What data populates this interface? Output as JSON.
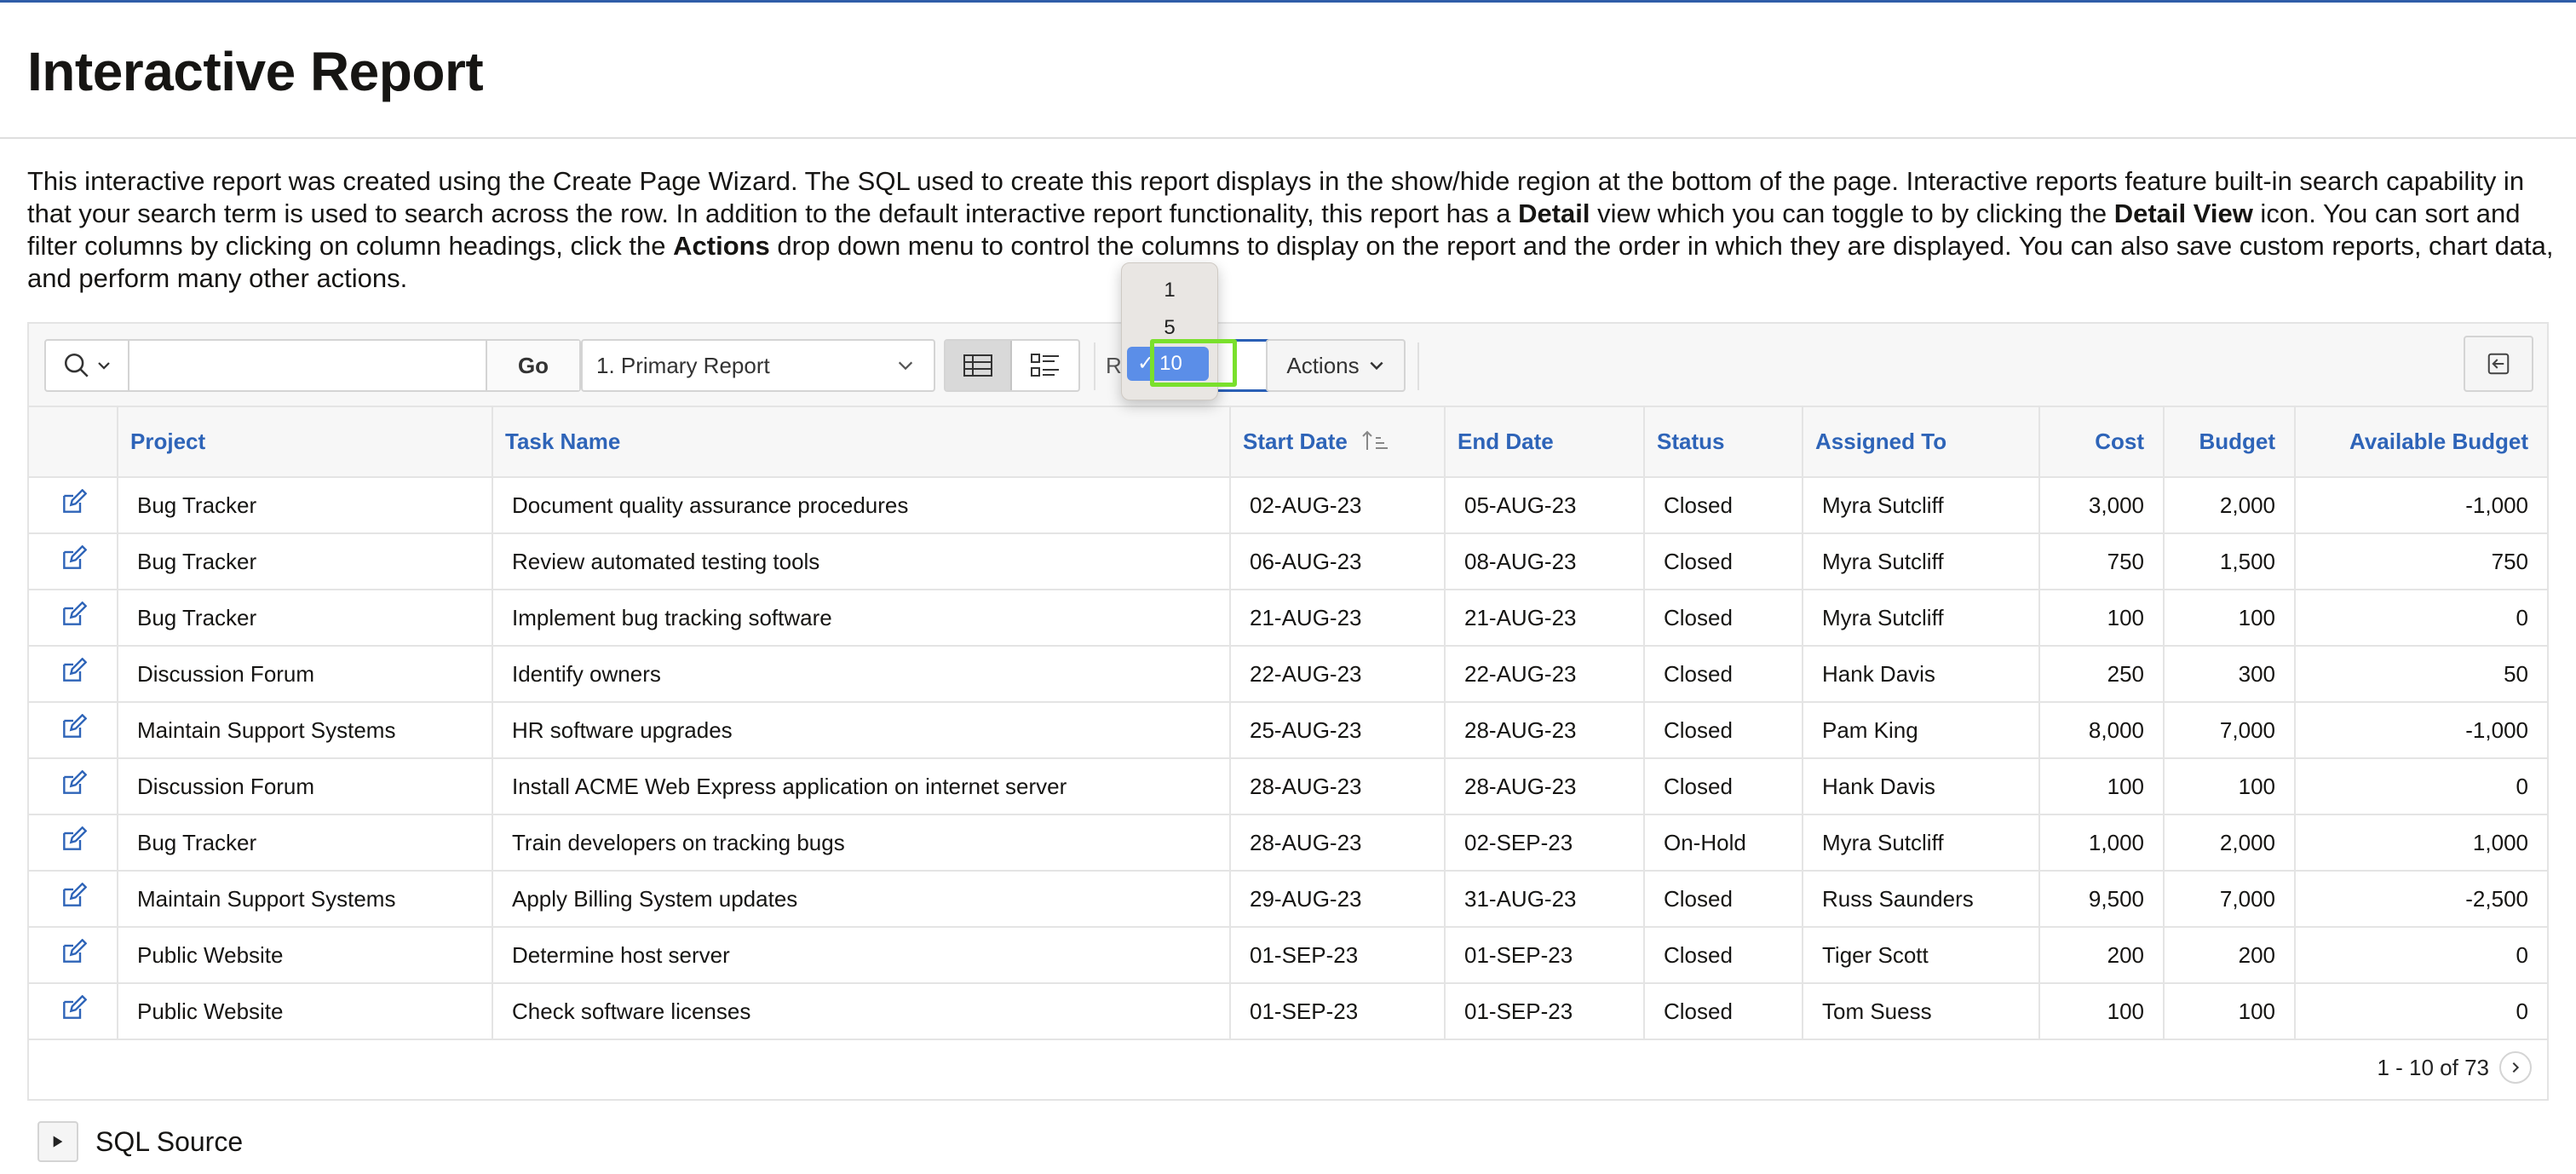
{
  "page": {
    "title": "Interactive Report",
    "description": [
      {
        "text": "This interactive report was created using the Create Page Wizard. The SQL used to create this report displays in the show/hide region at the bottom of the page. Interactive reports feature built-in search capability in that your search term is used to search across the row. In addition to the default interactive report functionality, this report has a ",
        "bold": false
      },
      {
        "text": "Detail",
        "bold": true
      },
      {
        "text": " view which you can toggle to by clicking the ",
        "bold": false
      },
      {
        "text": "Detail View",
        "bold": true
      },
      {
        "text": " icon. You can sort and filter columns by clicking on column headings, click the ",
        "bold": false
      },
      {
        "text": "Actions",
        "bold": true
      },
      {
        "text": " drop down menu to control the columns to display on the report and the order in which they are displayed. You can also save custom reports, chart data, and perform many other actions.",
        "bold": false
      }
    ]
  },
  "toolbar": {
    "search_value": "",
    "go_label": "Go",
    "report_selected": "1. Primary Report",
    "rows_label": "Row",
    "actions_label": "Actions"
  },
  "rows_menu": {
    "options": [
      "1",
      "5",
      "10"
    ],
    "selected": "10"
  },
  "table": {
    "columns": [
      "",
      "Project",
      "Task Name",
      "Start Date",
      "End Date",
      "Status",
      "Assigned To",
      "Cost",
      "Budget",
      "Available Budget"
    ],
    "sorted_column": "Start Date",
    "rows": [
      [
        "Bug Tracker",
        "Document quality assurance procedures",
        "02-AUG-23",
        "05-AUG-23",
        "Closed",
        "Myra Sutcliff",
        "3,000",
        "2,000",
        "-1,000"
      ],
      [
        "Bug Tracker",
        "Review automated testing tools",
        "06-AUG-23",
        "08-AUG-23",
        "Closed",
        "Myra Sutcliff",
        "750",
        "1,500",
        "750"
      ],
      [
        "Bug Tracker",
        "Implement bug tracking software",
        "21-AUG-23",
        "21-AUG-23",
        "Closed",
        "Myra Sutcliff",
        "100",
        "100",
        "0"
      ],
      [
        "Discussion Forum",
        "Identify owners",
        "22-AUG-23",
        "22-AUG-23",
        "Closed",
        "Hank Davis",
        "250",
        "300",
        "50"
      ],
      [
        "Maintain Support Systems",
        "HR software upgrades",
        "25-AUG-23",
        "28-AUG-23",
        "Closed",
        "Pam King",
        "8,000",
        "7,000",
        "-1,000"
      ],
      [
        "Discussion Forum",
        "Install ACME Web Express application on internet server",
        "28-AUG-23",
        "28-AUG-23",
        "Closed",
        "Hank Davis",
        "100",
        "100",
        "0"
      ],
      [
        "Bug Tracker",
        "Train developers on tracking bugs",
        "28-AUG-23",
        "02-SEP-23",
        "On-Hold",
        "Myra Sutcliff",
        "1,000",
        "2,000",
        "1,000"
      ],
      [
        "Maintain Support Systems",
        "Apply Billing System updates",
        "29-AUG-23",
        "31-AUG-23",
        "Closed",
        "Russ Saunders",
        "9,500",
        "7,000",
        "-2,500"
      ],
      [
        "Public Website",
        "Determine host server",
        "01-SEP-23",
        "01-SEP-23",
        "Closed",
        "Tiger Scott",
        "200",
        "200",
        "0"
      ],
      [
        "Public Website",
        "Check software licenses",
        "01-SEP-23",
        "01-SEP-23",
        "Closed",
        "Tom Suess",
        "100",
        "100",
        "0"
      ]
    ]
  },
  "pagination": {
    "text": "1 - 10 of 73"
  },
  "sql_source": {
    "title": "SQL Source"
  },
  "colors": {
    "accent": "#2e64b8",
    "focus": "#7ae02c",
    "selected_option": "#5b8ee8"
  }
}
